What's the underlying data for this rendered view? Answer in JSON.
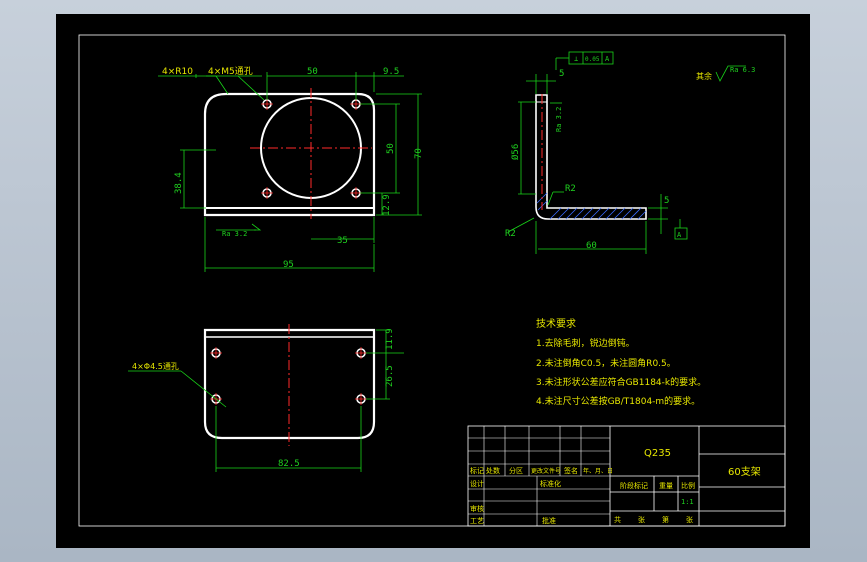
{
  "drawing": {
    "top_view": {
      "radius_note": "4×R10",
      "holes_note": "4×M5通孔",
      "dims": {
        "d50": "50",
        "d9_5": "9.5",
        "d50v": "50",
        "d70": "70",
        "d38_4": "38.4",
        "d12_9": "12.9",
        "d35": "35",
        "d95": "95"
      },
      "roughness": "Ra 3.2"
    },
    "side_view": {
      "datum_box": "0.05",
      "datum_letter": "A",
      "dims": {
        "d5_top": "5",
        "d56": "Ø56",
        "r2_inner": "R2",
        "r2_outer": "R2",
        "d60": "60",
        "d5_right": "5"
      },
      "roughness_side": "Ra 3.2",
      "datum_label": "A"
    },
    "surface_note": {
      "prefix": "其余",
      "value": "Ra 6.3"
    },
    "bottom_view": {
      "holes_note": "4×Φ4.5通孔",
      "dims": {
        "d11_9": "11.9",
        "d26_5": "26.5",
        "d82_5": "82.5"
      }
    },
    "tech_req": {
      "title": "技术要求",
      "items": [
        "1.去除毛刺，锐边倒钝。",
        "2.未注倒角C0.5，未注圆角R0.5。",
        "3.未注形状公差应符合GB1184-k的要求。",
        "4.未注尺寸公差按GB/T1804-m的要求。"
      ]
    },
    "title_block": {
      "material": "Q235",
      "part_name": "60支架",
      "row_labels": [
        "标记",
        "处数",
        "分区",
        "更改文件号",
        "签名",
        "年、月、日"
      ],
      "design": "设计",
      "standard": "标准化",
      "stage": "阶段标记",
      "weight": "重量",
      "scale_label": "比例",
      "scale_value": "1:1",
      "review": "审核",
      "process": "工艺",
      "approve": "批准",
      "sheets": [
        "共",
        "张",
        "第",
        "张"
      ]
    }
  },
  "colors": {
    "background": "#000000",
    "outline": "#ffffff",
    "dimension": "#1fd11f",
    "centerline": "#ff2a2a",
    "text": "#e6e600"
  }
}
